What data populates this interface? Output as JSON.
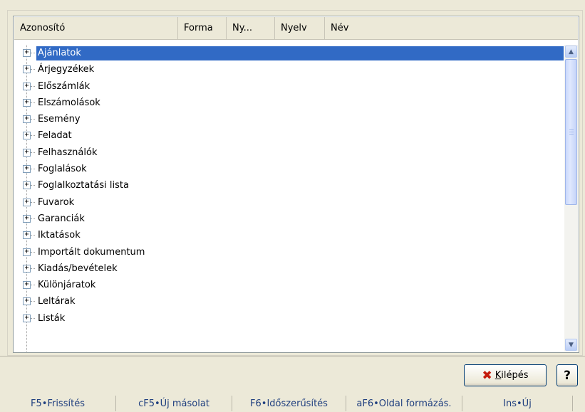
{
  "columns": [
    "Azonosító",
    "Forma",
    "Ny...",
    "Nyelv",
    "Név"
  ],
  "tree_items": [
    "Ajánlatok",
    "Árjegyzékek",
    "Előszámlák",
    "Elszámolások",
    "Esemény",
    "Feladat",
    "Felhasználók",
    "Foglalások",
    "Foglalkoztatási lista",
    "Fuvarok",
    "Garanciák",
    "Iktatások",
    "Importált dokumentum",
    "Kiadás/bevételek",
    "Különjáratok",
    "Leltárak",
    "Listák"
  ],
  "selected_item": "Ajánlatok",
  "expander_glyph": "+",
  "buttons": {
    "exit_prefix": "",
    "exit_key": "K",
    "exit_rest": "ilépés",
    "help": "?"
  },
  "statusbar": [
    "F5•Frissítés",
    "cF5•Új másolat",
    "F6•Időszerűsítés",
    "aF6•Oldal formázás.",
    "Ins•Új"
  ],
  "colors": {
    "selection": "#316ac5",
    "exit_icon": "#c41b0d",
    "statusbar_text": "#1f3f7f"
  }
}
